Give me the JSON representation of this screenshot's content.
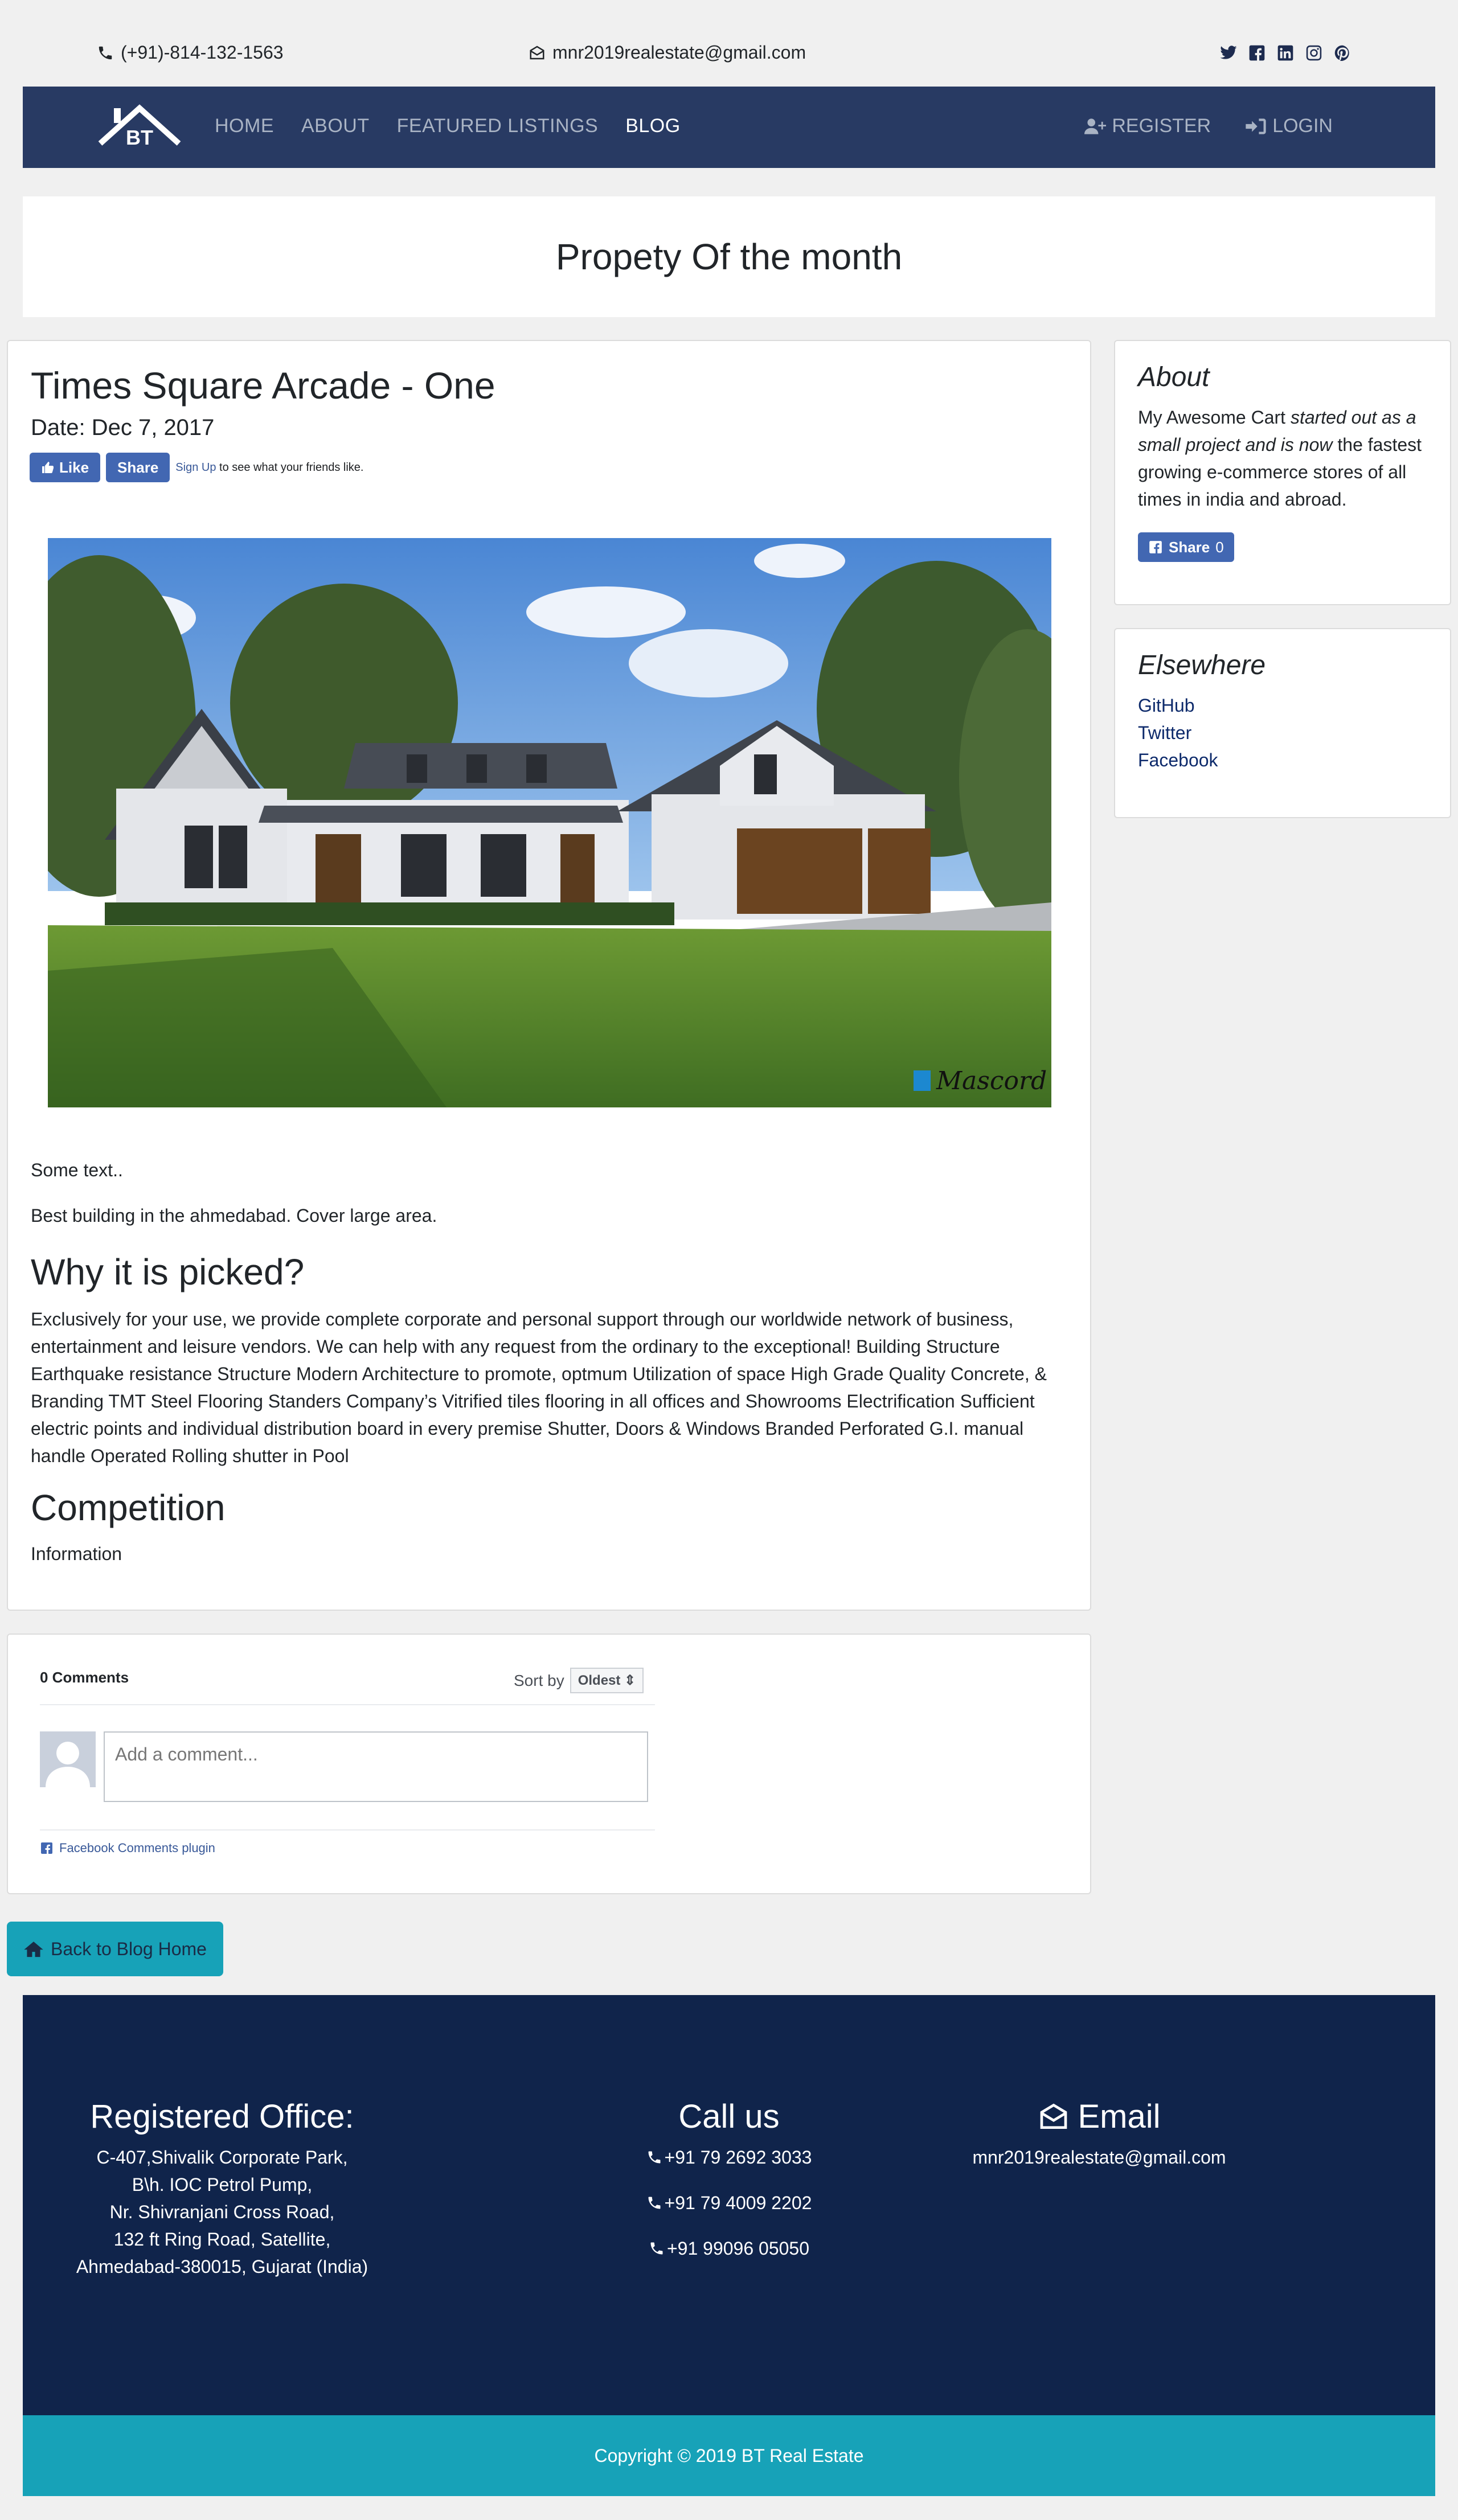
{
  "contact_bar": {
    "phone": "(+91)-814-132-1563",
    "email": "mnr2019realestate@gmail.com",
    "social_icons": [
      "twitter-icon",
      "facebook-icon",
      "linkedin-icon",
      "instagram-icon",
      "pinterest-icon"
    ]
  },
  "navbar": {
    "logo_text": "BT",
    "links": [
      "HOME",
      "ABOUT",
      "FEATURED LISTINGS",
      "BLOG"
    ],
    "active": "BLOG",
    "register": "REGISTER",
    "login": "LOGIN"
  },
  "hero": {
    "title": "Propety Of the month"
  },
  "post": {
    "title": "Times Square Arcade - One",
    "date": "Date: Dec 7, 2017",
    "fb_like": "Like",
    "fb_share": "Share",
    "fb_signup": "Sign Up",
    "fb_signup_text": " to see what your friends like.",
    "image_signature": "Mascord",
    "text1": "Some text..",
    "text2": "Best building in the ahmedabad. Cover large area.",
    "why_heading": "Why it is picked?",
    "why_body": "Exclusively for your use, we provide complete corporate and personal support through our worldwide network of business, entertainment and leisure vendors. We can help with any request from the ordinary to the exceptional! Building Structure Earthquake resistance Structure Modern Architecture to promote, optmum Utilization of space High Grade Quality Concrete, & Branding TMT Steel Flooring Standers Company’s Vitrified tiles flooring in all offices and Showrooms Electrification Sufficient electric points and individual distribution board in every premise Shutter, Doors & Windows Branded Perforated G.I. manual handle Operated Rolling shutter in Pool",
    "competition_heading": "Competition",
    "competition_body": "Information"
  },
  "sidebar": {
    "about_title": "About",
    "about_prefix": "My Awesome Cart ",
    "about_italic": "started out as a small project and is now",
    "about_suffix": " the fastest growing e-commerce stores of all times in india and abroad.",
    "share_label": "Share",
    "share_count": "0",
    "elsewhere_title": "Elsewhere",
    "links": [
      "GitHub",
      "Twitter",
      "Facebook"
    ]
  },
  "comments": {
    "count": "0 Comments",
    "sort_label": "Sort by",
    "sort_value": "Oldest",
    "placeholder": "Add a comment...",
    "plugin": "Facebook Comments plugin"
  },
  "back_button": "Back to Blog Home",
  "footer": {
    "office_title": "Registered Office:",
    "office_lines": [
      "C-407,Shivalik Corporate Park,",
      "B\\h. IOC Petrol Pump,",
      "Nr. Shivranjani Cross Road,",
      "132 ft Ring Road, Satellite,",
      "Ahmedabad-380015, Gujarat (India)"
    ],
    "call_title": "Call us",
    "phones": [
      "+91 79 2692 3033",
      "+91 79 4009 2202",
      "+91 99096 05050"
    ],
    "email_title": "Email",
    "email": "mnr2019realestate@gmail.com",
    "copyright": "Copyright © 2019 BT Real Estate"
  },
  "colors": {
    "navbar": "#283a63",
    "footer": "#10244b",
    "accent_teal": "#17a2b8",
    "facebook_blue": "#4267b2"
  }
}
